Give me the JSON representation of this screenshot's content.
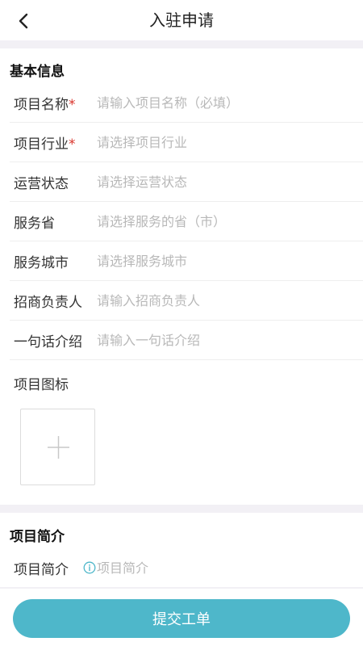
{
  "header": {
    "title": "入驻申请"
  },
  "basic_section": {
    "title": "基本信息",
    "fields": [
      {
        "label": "项目名称",
        "required": true,
        "placeholder": "请输入项目名称（必填）"
      },
      {
        "label": "项目行业",
        "required": true,
        "placeholder": "请选择项目行业"
      },
      {
        "label": "运营状态",
        "required": false,
        "placeholder": "请选择运营状态"
      },
      {
        "label": "服务省",
        "required": false,
        "placeholder": "请选择服务的省（市）"
      },
      {
        "label": "服务城市",
        "required": false,
        "placeholder": "请选择服务城市"
      },
      {
        "label": "招商负责人",
        "required": false,
        "placeholder": "请输入招商负责人"
      },
      {
        "label": "一句话介绍",
        "required": false,
        "placeholder": "请输入一句话介绍"
      }
    ],
    "icon_label": "项目图标",
    "required_mark": "*"
  },
  "intro_section": {
    "title": "项目简介",
    "field_label": "项目简介",
    "field_placeholder": "项目简介"
  },
  "footer": {
    "submit_label": "提交工单"
  },
  "colors": {
    "accent": "#4eb7ca",
    "required": "#d9342b",
    "divider": "#f2f0f5"
  }
}
